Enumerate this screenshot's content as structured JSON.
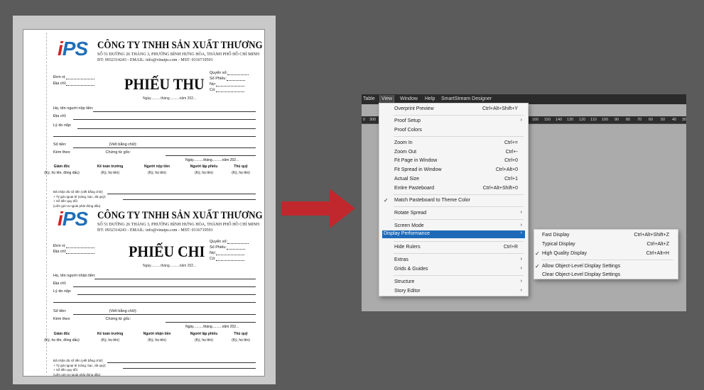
{
  "document": {
    "logo": "iPS",
    "company": "CÔNG TY TNHH SẢN XUẤT THƯƠNG MẠI IPS",
    "address": "SỐ 51 ĐƯỜNG 26 THÁNG 3, PHƯỜNG BÌNH HƯNG HÒA, THÀNH PHỐ HỒ CHÍ MINH",
    "contact": "ĐT: 0932314243   -   EMAIL: info@vinaips.com   -   MST: 0316719591",
    "receipt_title": "PHIẾU THU",
    "payment_title": "PHIẾU CHI",
    "date_line": "Ngày..........tháng..........năm 202...",
    "meta": {
      "unit": "Đơn vị:",
      "address": "Địa chỉ:",
      "book": "Quyển số:",
      "number": "Số Phiếu:",
      "debit": "Nợ:",
      "credit": "Có:"
    },
    "fields": {
      "payer": "Họ, tên người nộp tiền:",
      "payee": "Họ, tên người nhận tiền:",
      "addr": "Địa chỉ:",
      "reason": "Lý do nộp:",
      "amount": "Số tiền:",
      "in_words": "(Viết bằng chữ):",
      "attached": "Kèm theo",
      "original_docs": "Chứng từ gốc:"
    },
    "sign_date": "Ngày..........tháng..........năm 202...",
    "signers": [
      {
        "title": "Giám đốc",
        "note": "(Ký, họ tên, đóng dấu)"
      },
      {
        "title": "Kế toán trưởng",
        "note": "(Ký, họ tên)"
      },
      {
        "title": "Người nộp tiền",
        "note": "(Ký, họ tên)"
      },
      {
        "title": "Người lập phiếu",
        "note": "(Ký, họ tên)"
      },
      {
        "title": "Thủ quỹ",
        "note": "(Ký, họ tên)"
      }
    ],
    "signers_payment": [
      {
        "title": "Giám đốc",
        "note": "(Ký, họ tên, đóng dấu)"
      },
      {
        "title": "Kế toán trưởng",
        "note": "(Ký, họ tên)"
      },
      {
        "title": "Người nhận tiền",
        "note": "(Ký, họ tên)"
      },
      {
        "title": "Người lập phiếu",
        "note": "(Ký, họ tên)"
      },
      {
        "title": "Thủ quỹ",
        "note": "(Ký, họ tên)"
      }
    ],
    "fine": {
      "received": "Đã nhận đủ số tiền (viết bằng chữ):",
      "gem": "+ Tỷ giá ngoại tệ (vàng, bạc, đá quý):",
      "converted": "+ Số tiền quy đổi:",
      "note": "(Liên gửi ra ngoài phải đóng dấu)"
    }
  },
  "app": {
    "menubar": [
      "Table",
      "View",
      "Window",
      "Help",
      "SmartStream Designer"
    ],
    "ruler_ticks": [
      "0",
      "300",
      "160",
      "150",
      "140",
      "130",
      "120",
      "110",
      "100",
      "90",
      "80",
      "70",
      "60",
      "50",
      "40",
      "30"
    ],
    "menu": [
      {
        "label": "Overprint Preview",
        "shortcut": "Ctrl+Alt+Shift+Y"
      },
      {
        "label": "Proof Setup",
        "submenu": true
      },
      {
        "label": "Proof Colors"
      },
      {
        "label": "Zoom In",
        "shortcut": "Ctrl+="
      },
      {
        "label": "Zoom Out",
        "shortcut": "Ctrl+-"
      },
      {
        "label": "Fit Page in Window",
        "shortcut": "Ctrl+0"
      },
      {
        "label": "Fit Spread in Window",
        "shortcut": "Ctrl+Alt+0"
      },
      {
        "label": "Actual Size",
        "shortcut": "Ctrl+1"
      },
      {
        "label": "Entire Pasteboard",
        "shortcut": "Ctrl+Alt+Shift+0"
      },
      {
        "label": "Match Pasteboard to Theme Color",
        "checked": true
      },
      {
        "label": "Rotate Spread",
        "submenu": true
      },
      {
        "label": "Screen Mode",
        "submenu": true
      },
      {
        "label": "Display Performance",
        "submenu": true,
        "highlighted": true
      },
      {
        "label": "Hide Rulers",
        "shortcut": "Ctrl+R"
      },
      {
        "label": "Extras",
        "submenu": true
      },
      {
        "label": "Grids & Guides",
        "submenu": true
      },
      {
        "label": "Structure",
        "submenu": true
      },
      {
        "label": "Story Editor",
        "submenu": true
      }
    ],
    "submenu": [
      {
        "label": "Fast Display",
        "shortcut": "Ctrl+Alt+Shift+Z"
      },
      {
        "label": "Typical Display",
        "shortcut": "Ctrl+Alt+Z"
      },
      {
        "label": "High Quality Display",
        "shortcut": "Ctrl+Alt+H",
        "checked": true
      },
      {
        "label": "Allow Object-Level Display Settings",
        "checked": true
      },
      {
        "label": "Clear Object-Level Display Settings"
      }
    ],
    "highlight_color": "#1e6ab8"
  },
  "arrow_color": "#c0282d"
}
